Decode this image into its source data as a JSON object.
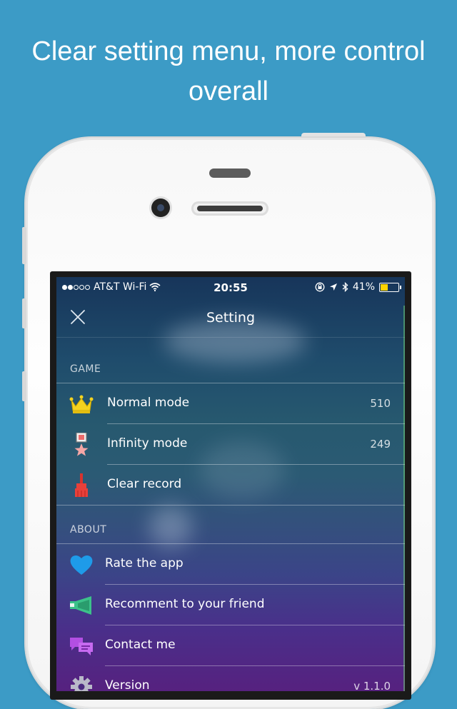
{
  "headline": {
    "line1": "Clear setting menu, more control",
    "line2": "overall"
  },
  "status_bar": {
    "carrier": "AT&T Wi-Fi",
    "signal_dots_filled": 2,
    "signal_dots_total": 5,
    "time": "20:55",
    "battery_percent_label": "41%",
    "battery_level": 0.41
  },
  "nav": {
    "title": "Setting",
    "close_icon": "close-icon"
  },
  "sections": [
    {
      "title": "GAME",
      "items": [
        {
          "label": "Normal mode",
          "value": "510",
          "icon": "crown-icon"
        },
        {
          "label": "Infinity mode",
          "value": "249",
          "icon": "medal-icon"
        },
        {
          "label": "Clear record",
          "value": "",
          "icon": "broom-icon"
        }
      ]
    },
    {
      "title": "ABOUT",
      "items": [
        {
          "label": "Rate the app",
          "value": "",
          "icon": "heart-icon"
        },
        {
          "label": "Recomment to your friend",
          "value": "",
          "icon": "megaphone-icon"
        },
        {
          "label": "Contact me",
          "value": "",
          "icon": "chat-bubbles-icon"
        },
        {
          "label": "Version",
          "value": "v 1.1.0",
          "icon": "gear-icon"
        }
      ]
    }
  ],
  "colors": {
    "page_background": "#3c9bc6",
    "crown": "#f4d21f",
    "heart": "#1e9be9",
    "megaphone": "#3cc28a",
    "chat": "#b34fe3",
    "broom": "#e8403a"
  }
}
